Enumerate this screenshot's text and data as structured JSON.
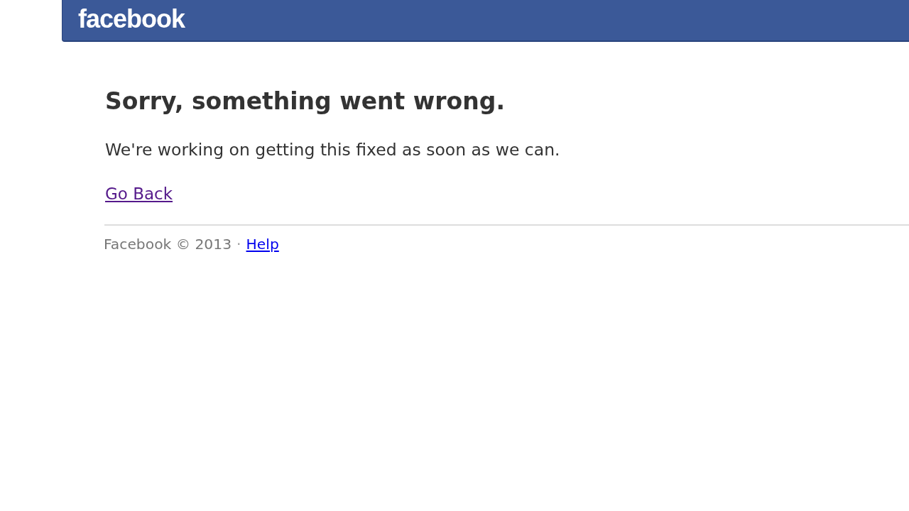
{
  "header": {
    "logo": "facebook"
  },
  "error": {
    "title": "Sorry, something went wrong.",
    "message": "We're working on getting this fixed as soon as we can.",
    "link": {
      "label": "Go Back",
      "visited": true
    }
  },
  "footer": {
    "copyright": "Facebook © 2013",
    "separator": "·",
    "link": {
      "label": "Help",
      "visited": false
    }
  }
}
